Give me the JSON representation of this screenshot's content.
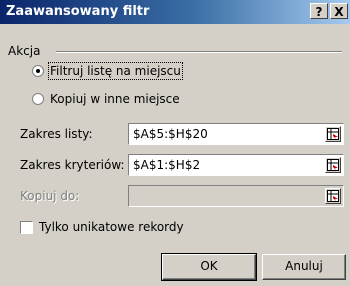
{
  "window": {
    "title": "Zaawansowany filtr",
    "help_label": "?",
    "close_label": "X"
  },
  "action_group": {
    "label": "Akcja",
    "options": [
      {
        "label": "Filtruj listę na miejscu",
        "checked": true
      },
      {
        "label": "Kopiuj w inne miejsce",
        "checked": false
      }
    ]
  },
  "fields": {
    "list_range": {
      "label": "Zakres listy:",
      "value": "$A$5:$H$20"
    },
    "criteria_range": {
      "label": "Zakres kryteriów:",
      "value": "$A$1:$H$2"
    },
    "copy_to": {
      "label": "Kopiuj do:",
      "value": "",
      "disabled": true
    }
  },
  "unique_records": {
    "label": "Tylko unikatowe rekordy",
    "checked": false
  },
  "buttons": {
    "ok": "OK",
    "cancel": "Anuluj"
  }
}
